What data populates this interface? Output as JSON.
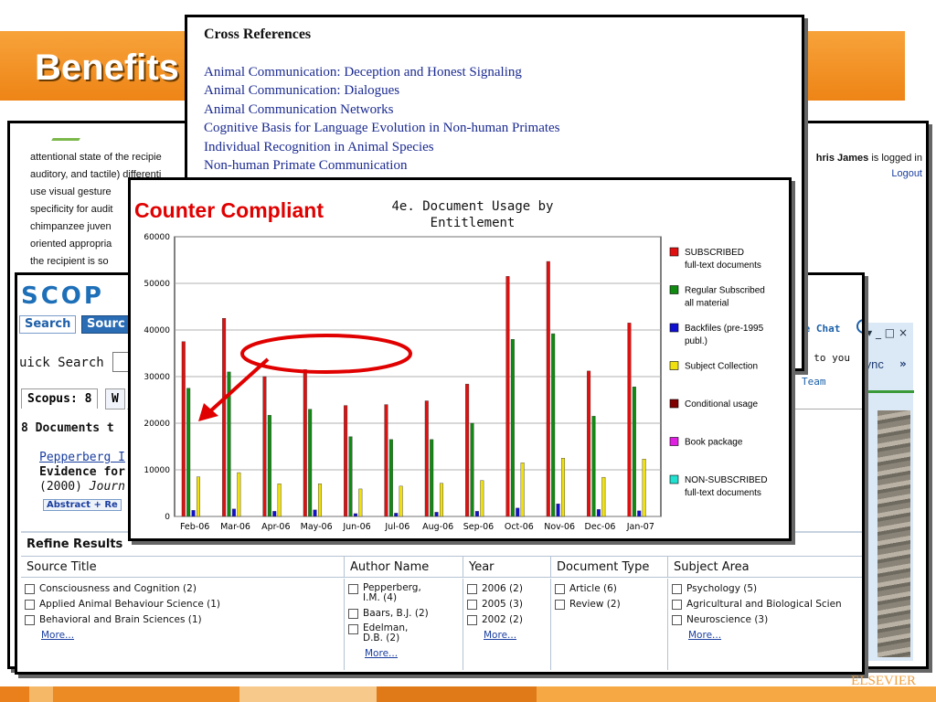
{
  "slide": {
    "title": "Benefits",
    "footer_brand": "ELSEVIER",
    "footer_colors": [
      "#e9801c",
      "#f5b867",
      "#ec8a24",
      "#f7c98a",
      "#e07a18",
      "#f6a845"
    ]
  },
  "article": {
    "lines": [
      "attentional state of the recipie",
      "auditory, and tactile) differenti",
      "use visual gesture",
      "specificity for audit",
      "chimpanzee juven",
      "oriented appropria",
      "the recipient is so"
    ],
    "user_name": "hris James",
    "logged_in_suffix": " is logged in",
    "logout_label": "Logout"
  },
  "browser": {
    "window_controls": "▾  _  □  ×",
    "sync_label": "Sync",
    "more_label": "»"
  },
  "scopus": {
    "logo": "SCOP",
    "tabs": [
      "Search",
      "Sourc"
    ],
    "quick_search_label": "uick Search",
    "scopus_tab": "Scopus: 8",
    "w_tab": "W",
    "docs_found": "8  Documents t",
    "result": {
      "author": "Pepperberg I",
      "title": "Evidence for",
      "year_prefix": "(2000) ",
      "journal": "Journ",
      "abstract_label": "Abstract + Re"
    },
    "live_chat": "ve Chat",
    "sent_to_line1": "t to you b",
    "sent_to_team": "Team",
    "refine": {
      "title": "Refine Results",
      "columns": [
        "Source Title",
        "Author Name",
        "Year",
        "Document Type",
        "Subject Area"
      ],
      "source_titles": [
        "Consciousness and Cognition (2)",
        "Applied Animal Behaviour Science (1)",
        "Behavioral and Brain Sciences (1)"
      ],
      "authors": [
        "Pepperberg,\nI.M. (4)",
        "Baars, B.J. (2)",
        "Edelman,\nD.B. (2)"
      ],
      "years": [
        "2006 (2)",
        "2005 (3)",
        "2002 (2)"
      ],
      "doc_types": [
        "Article (6)",
        "Review (2)"
      ],
      "subjects": [
        "Psychology (5)",
        "Agricultural and Biological Scien",
        "Neuroscience (3)"
      ],
      "more_label": "More..."
    }
  },
  "cross_references": {
    "title": "Cross References",
    "items": [
      "Animal Communication: Deception and Honest Signaling",
      "Animal Communication: Dialogues",
      "Animal Communication Networks",
      "Cognitive Basis for Language Evolution in Non-human Primates",
      "Individual Recognition in Animal Species",
      "Non-human Primate Communication"
    ]
  },
  "chart_label": "Counter Compliant",
  "chart_data": {
    "type": "bar",
    "title_line1": "4e. Document Usage by",
    "title_line2": "Entitlement",
    "categories": [
      "Feb-06",
      "Mar-06",
      "Apr-06",
      "May-06",
      "Jun-06",
      "Jul-06",
      "Aug-06",
      "Sep-06",
      "Oct-06",
      "Nov-06",
      "Dec-06",
      "Jan-07"
    ],
    "ylim": [
      0,
      60000
    ],
    "yticks": [
      "0",
      "10000",
      "20000",
      "30000",
      "40000",
      "50000",
      "60000"
    ],
    "grid": true,
    "legend_position": "right",
    "series": [
      {
        "name": "SUBSCRIBED full-text documents",
        "color": "#e01010",
        "values": [
          37500,
          42500,
          30000,
          31500,
          23800,
          24000,
          24800,
          28400,
          51500,
          54700,
          31200,
          41500
        ]
      },
      {
        "name": "Regular Subscribed all material",
        "color": "#108a10",
        "values": [
          27500,
          31000,
          21700,
          23000,
          17100,
          16500,
          16500,
          20000,
          38000,
          39200,
          21500,
          27800
        ]
      },
      {
        "name": "Backfiles (pre-1995 publ.)",
        "color": "#1010d0",
        "values": [
          1300,
          1600,
          1100,
          1400,
          600,
          700,
          900,
          1100,
          1800,
          2700,
          1500,
          1200
        ]
      },
      {
        "name": "Subject Collection",
        "color": "#f0e010",
        "values": [
          8500,
          9400,
          7000,
          7000,
          5900,
          6500,
          7100,
          7700,
          11500,
          12500,
          8400,
          12300
        ]
      },
      {
        "name": "Conditional usage",
        "color": "#800000",
        "values": [
          0,
          0,
          0,
          0,
          0,
          0,
          0,
          0,
          0,
          0,
          0,
          0
        ]
      },
      {
        "name": "Book package",
        "color": "#e020e0",
        "values": [
          0,
          0,
          0,
          0,
          0,
          0,
          0,
          0,
          0,
          0,
          0,
          0
        ]
      },
      {
        "name": "NON-SUBSCRIBED full-text documents",
        "color": "#20e0d0",
        "values": [
          0,
          0,
          0,
          0,
          0,
          0,
          0,
          0,
          0,
          0,
          0,
          0
        ]
      }
    ]
  }
}
